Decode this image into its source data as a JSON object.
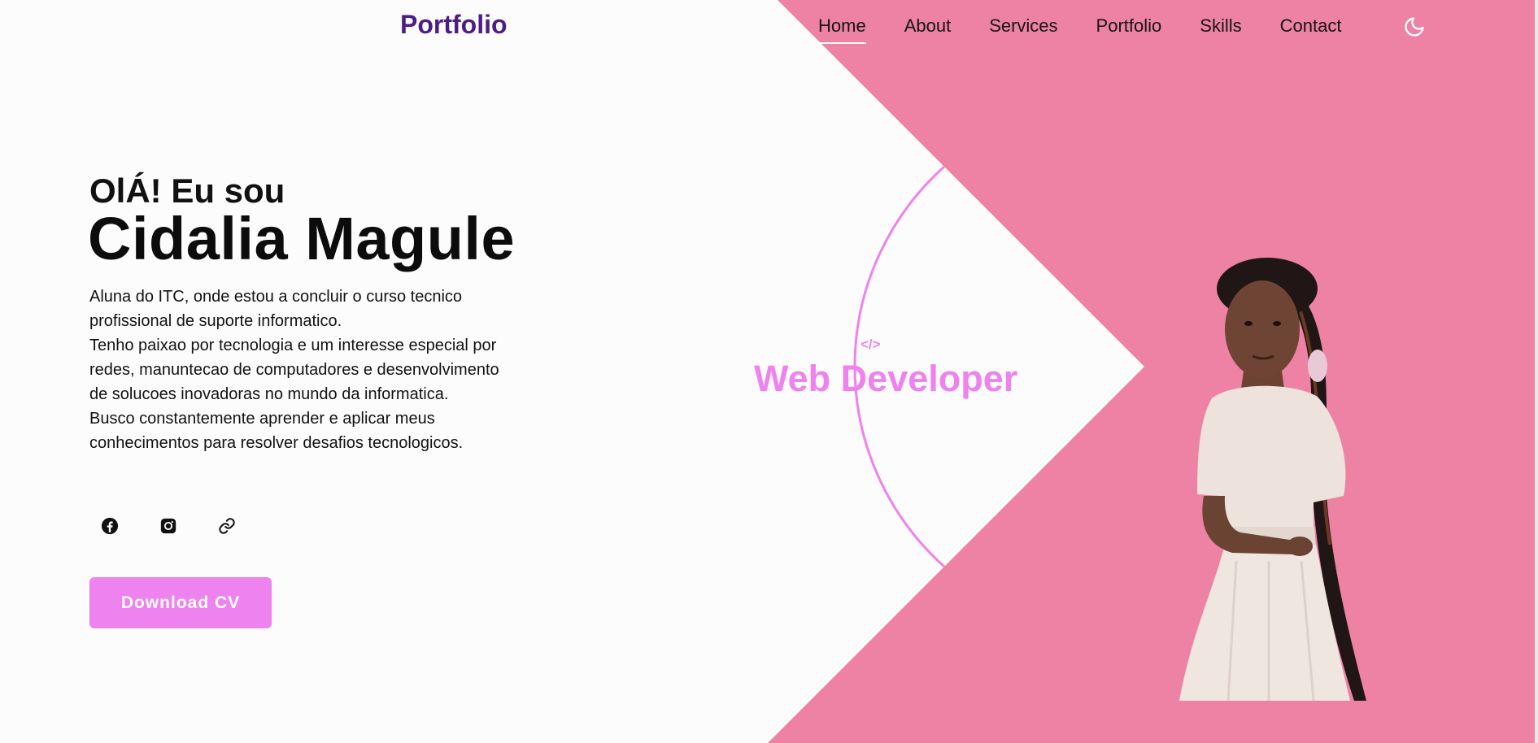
{
  "header": {
    "logo": "Portfolio",
    "nav": [
      "Home",
      "About",
      "Services",
      "Portfolio",
      "Skills",
      "Contact"
    ],
    "active_nav": "Home",
    "theme_icon": "moon-icon"
  },
  "hero": {
    "greeting": "OlÁ! Eu sou",
    "name": "Cidalia Magule",
    "bio_lines": [
      "Aluna do ITC, onde estou a concluir o curso tecnico profissional de suporte informatico.",
      "Tenho paixao por tecnologia e um interesse especial por redes, manuntecao de computadores e desenvolvimento",
      "de solucoes inovadoras no mundo da informatica.",
      "Busco constantemente aprender e aplicar meus conhecimentos para resolver desafios tecnologicos."
    ],
    "socials": [
      "facebook-icon",
      "instagram-icon",
      "link-icon"
    ],
    "cv_button": "Download CV"
  },
  "badge": {
    "code_symbol": "</>",
    "role": "Web Developer"
  },
  "colors": {
    "accent_pink": "#ee82ee",
    "brand_purple": "#4b1d86",
    "panel_pink": "#ee82a5",
    "background": "#fdfcfc"
  }
}
